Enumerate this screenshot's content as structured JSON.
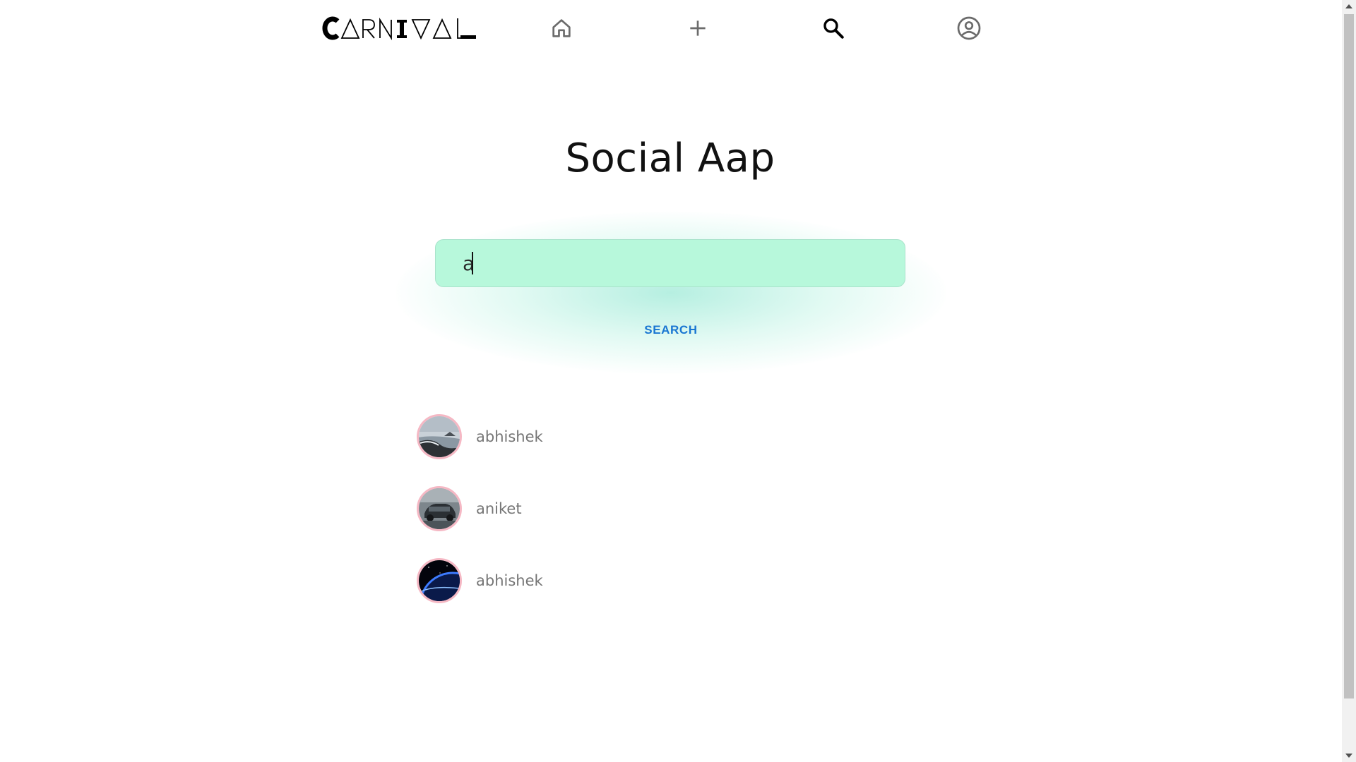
{
  "nav": {
    "logo_text": "CARNIVAL",
    "items": [
      {
        "icon": "home-icon"
      },
      {
        "icon": "plus-icon"
      },
      {
        "icon": "search-icon"
      },
      {
        "icon": "account-circle-icon"
      }
    ]
  },
  "page": {
    "title": "Social Aap"
  },
  "search": {
    "value": "a",
    "button_label": "SEARCH"
  },
  "results": [
    {
      "name": "abhishek",
      "avatar": "coastline-photo"
    },
    {
      "name": "aniket",
      "avatar": "car-photo"
    },
    {
      "name": "abhishek",
      "avatar": "earth-from-space-photo"
    }
  ],
  "colors": {
    "search_bg": "#b7f8db",
    "search_button": "#1976d2",
    "avatar_border": "#f5b8c4",
    "result_text": "#757575"
  }
}
